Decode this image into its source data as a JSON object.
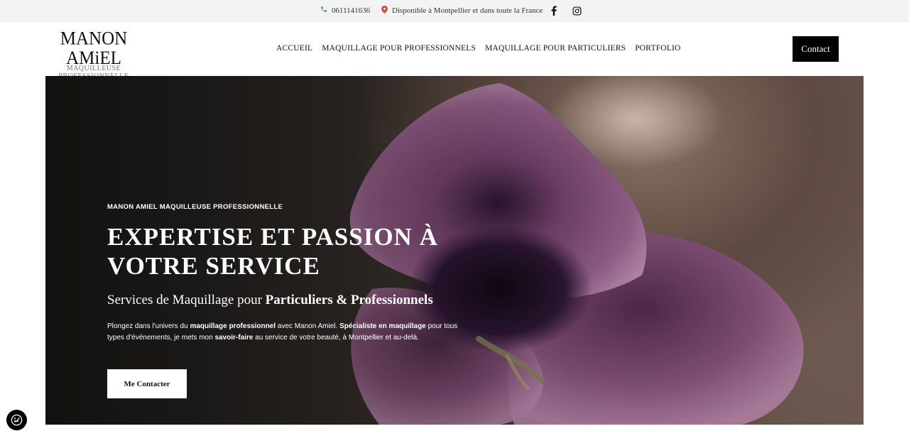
{
  "topbar": {
    "phone": "0611141636",
    "location": "Disponible à Montpellier et dans toute la France",
    "icons": {
      "phone": "phone-icon",
      "location": "map-pin-icon",
      "facebook": "facebook-icon",
      "instagram": "instagram-icon"
    },
    "colors": {
      "phone_icon": "#3a9a3a",
      "pin_icon": "#d04a3a"
    }
  },
  "header": {
    "logo": {
      "name": "MANON AMiEL",
      "subtitle": "MAQUILLEUSE PROFESSIONNELLE"
    },
    "nav": [
      {
        "label": "ACCUEIL"
      },
      {
        "label": "MAQUILLAGE POUR PROFESSIONNELS"
      },
      {
        "label": "MAQUILLAGE POUR PARTICULIERS"
      },
      {
        "label": "PORTFOLIO"
      }
    ],
    "contact_label": "Contact"
  },
  "hero": {
    "kicker": "MANON AMIEL MAQUILLEUSE PROFESSIONNELLE",
    "title": "EXPERTISE ET PASSION À VOTRE SERVICE",
    "subtitle_plain": "Services de Maquillage pour ",
    "subtitle_bold": "Particuliers & Professionnels",
    "desc": {
      "p1": "Plongez dans l'univers du ",
      "b1": "maquillage professionnel",
      "p2": " avec Manon Amiel. ",
      "b2": "Spécialiste en maquillage",
      "p3": " pour tous types d'événements, je mets mon ",
      "b3": "savoir-faire",
      "p4": " au service de votre beauté, à Montpellier et au-delà."
    },
    "cta_label": "Me Contacter"
  },
  "cookie": {
    "icon": "cookie-settings-icon"
  }
}
